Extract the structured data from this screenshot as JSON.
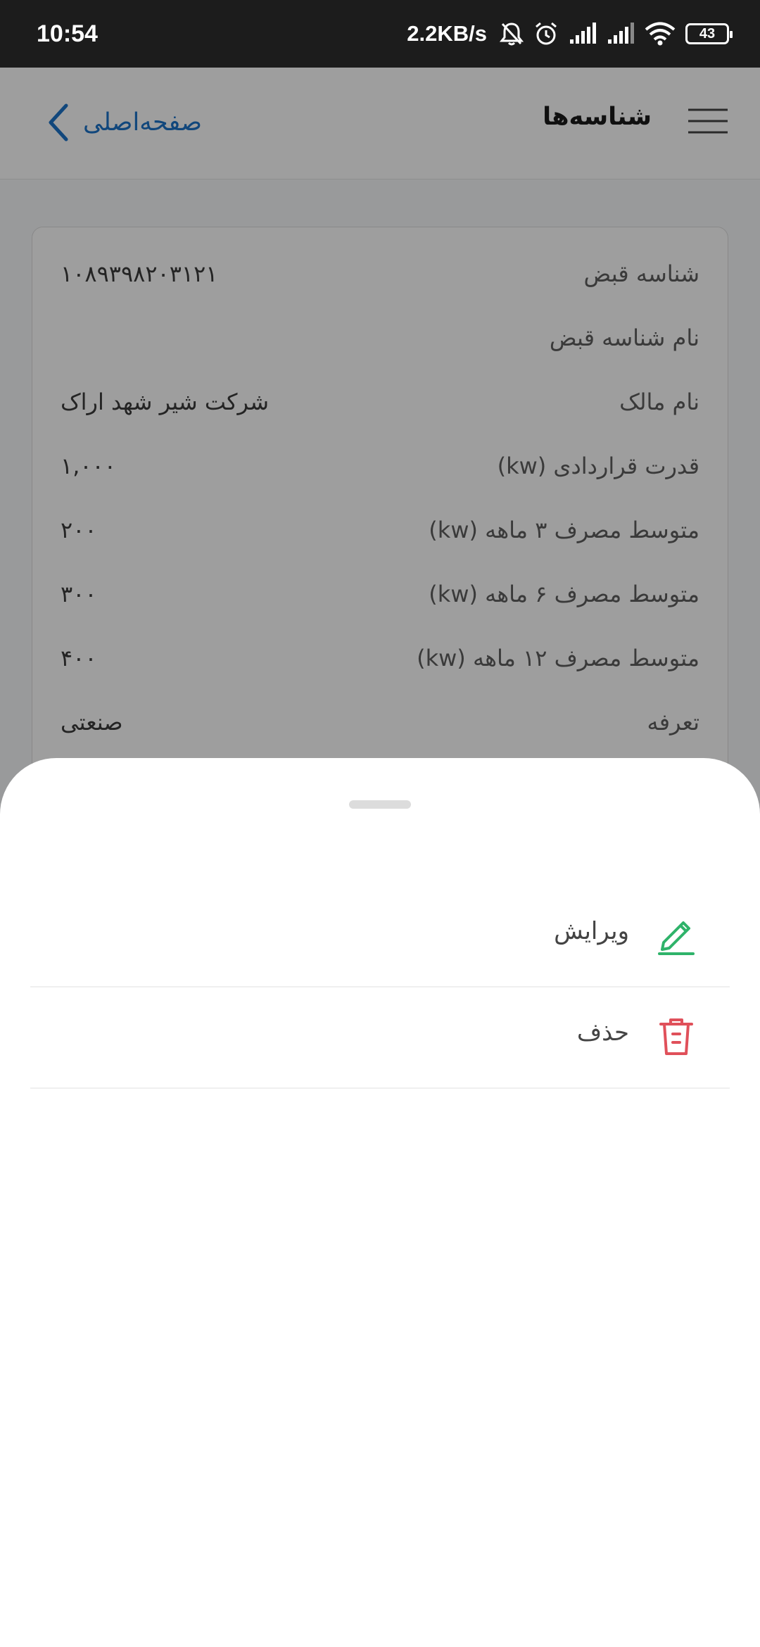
{
  "status_bar": {
    "time": "10:54",
    "net_speed": "2.2KB/s",
    "battery": "43",
    "icons": [
      "bell-off-icon",
      "alarm-icon",
      "signal-icon",
      "signal-icon",
      "wifi-icon",
      "battery-icon"
    ]
  },
  "header": {
    "title": "شناسه‌ها",
    "home_label": "صفحه‌اصلی",
    "menu_icon": "hamburger-menu-icon",
    "back_icon": "chevron-left-icon",
    "accent_color": "#1c73c9"
  },
  "card": {
    "rows": [
      {
        "label": "شناسه قبض",
        "value": "۱۰۸۹۳۹۸۲۰۳۱۲۱"
      },
      {
        "label": "نام شناسه قبض",
        "value": ""
      },
      {
        "label": "نام مالک",
        "value": "شرکت شیر شهد اراک"
      },
      {
        "label": "قدرت قراردادی (kw)",
        "value": "۱,۰۰۰"
      },
      {
        "label": "متوسط مصرف ۳ ماهه (kw)",
        "value": "۲۰۰"
      },
      {
        "label": "متوسط مصرف ۶ ماهه (kw)",
        "value": "۳۰۰"
      },
      {
        "label": "متوسط مصرف ۱۲ ماهه (kw)",
        "value": "۴۰۰"
      },
      {
        "label": "تعرفه",
        "value": "صنعتی"
      }
    ]
  },
  "sheet": {
    "actions": [
      {
        "label": "ویرایش",
        "icon": "pencil-icon",
        "color": "#2fb36a"
      },
      {
        "label": "حذف",
        "icon": "trash-icon",
        "color": "#e0505a"
      }
    ]
  }
}
